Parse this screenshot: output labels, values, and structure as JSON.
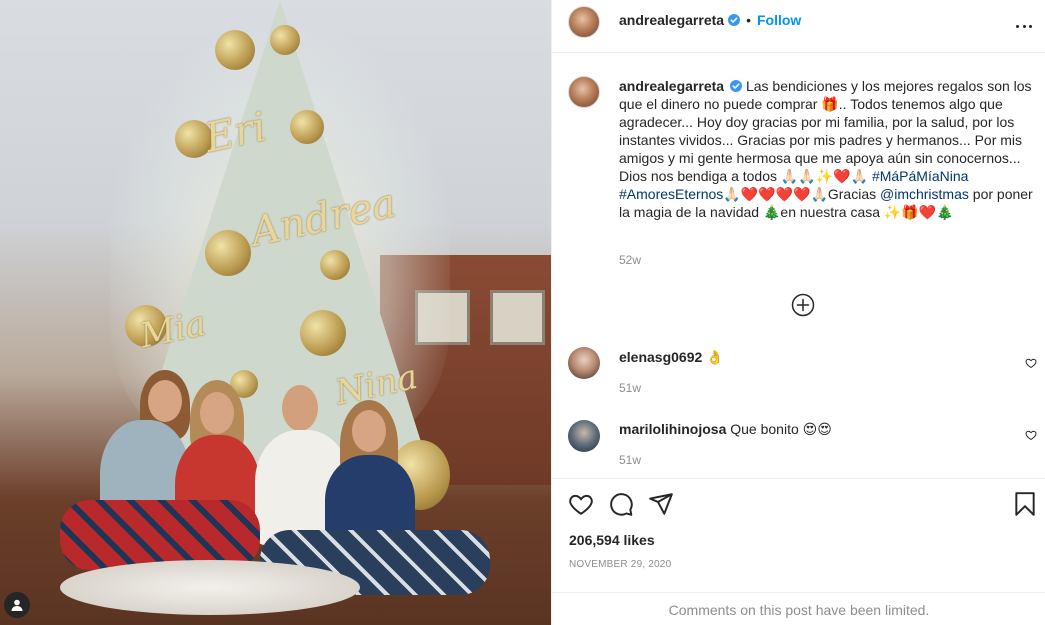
{
  "post": {
    "owner": {
      "username": "andrealegarreta",
      "verified": true,
      "follow_label": "Follow",
      "separator": "•"
    },
    "caption": {
      "text_part1": "Las bendiciones y los mejores regalos son los que el dinero no puede comprar 🎁.. Todos tenemos algo que agradecer... Hoy doy gracias por mi familia, por la salud, por los instantes vividos... Gracias por mis padres y hermanos... Por mis amigos y mi gente hermosa que me apoya aún sin conocernos... Dios nos bendiga a todos 🙏🏻🙏🏻✨❤️🙏🏻",
      "hashtag1": "#MáPáMíaNina",
      "hashtag2": "#AmoresEternos",
      "text_part2": "🙏🏻❤️❤️❤️❤️🙏🏻Gracias",
      "mention": "@imchristmas",
      "text_part3": "por poner la magia de la navidad 🎄en nuestra casa ✨🎁❤️🎄",
      "time": "52w"
    },
    "comments": [
      {
        "username": "elenasg0692",
        "text": "👌",
        "time": "51w"
      },
      {
        "username": "marilolihinojosa",
        "text": "Que bonito 😍😍",
        "time": "51w"
      }
    ],
    "likes": "206,594 likes",
    "date": "November 29, 2020",
    "comments_limited": "Comments on this post have been limited."
  },
  "icons": {
    "more": "more-options-icon",
    "verified": "verified-badge-icon",
    "load_more": "plus-circle-icon",
    "like": "heart-icon",
    "comment": "comment-icon",
    "share": "share-icon",
    "save": "bookmark-icon",
    "tagged": "user-tag-icon"
  },
  "colors": {
    "link_blue": "#0095f6",
    "tag_blue": "#00376b",
    "muted": "#8e8e8e",
    "text": "#262626",
    "heart_red": "#ed4956"
  }
}
